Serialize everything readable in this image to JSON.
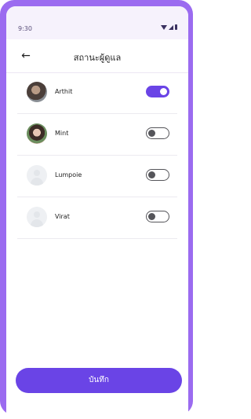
{
  "status_bar": {
    "time": "9:30",
    "icons": [
      "wifi-icon",
      "signal-icon",
      "battery-icon"
    ]
  },
  "app_bar": {
    "back_icon": "arrow-left-icon",
    "title": "สถานะผู้ดูแล"
  },
  "caregivers": [
    {
      "name": "Arthit",
      "avatar": "photo",
      "enabled": true
    },
    {
      "name": "Mint",
      "avatar": "photo",
      "enabled": false
    },
    {
      "name": "Lumpoie",
      "avatar": "placeholder",
      "enabled": false
    },
    {
      "name": "Virat",
      "avatar": "placeholder",
      "enabled": false
    }
  ],
  "actions": {
    "save_label": "บันทึก"
  },
  "colors": {
    "accent": "#6a44e6",
    "frame": "#9b6bf0"
  }
}
